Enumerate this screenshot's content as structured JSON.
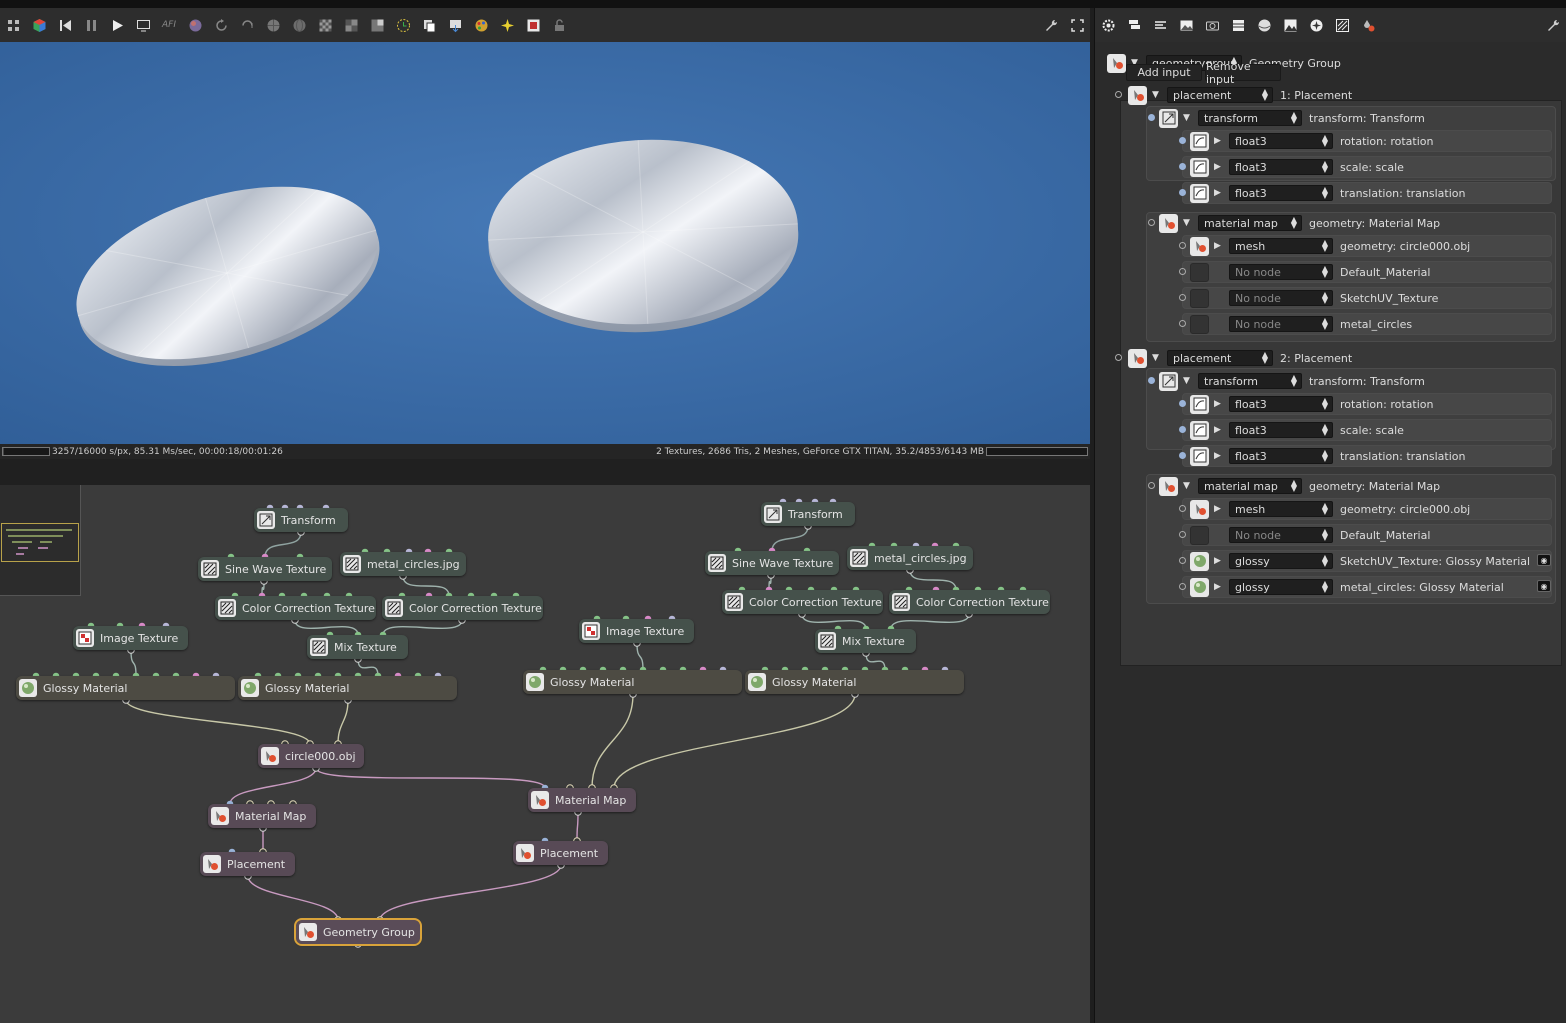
{
  "toolbar_left": {
    "icons": [
      "grid-snap-icon",
      "render-cube-icon",
      "skip-back-icon",
      "pause-icon",
      "play-icon",
      "screen-icon",
      "afi-icon",
      "color-sphere-icon",
      "rotate-icon",
      "refresh-icon",
      "globe-icon",
      "globe2-icon",
      "checker-icon",
      "checker2-icon",
      "checker3-icon",
      "clock-icon",
      "copy-icon",
      "export-icon",
      "palette-icon",
      "sparkle-icon",
      "focus-icon",
      "lock-icon"
    ],
    "afi_label": "AFI"
  },
  "toolbar_right": {
    "icons": [
      "settings-icon",
      "stack-icon",
      "layers-icon",
      "image-icon",
      "camera-icon",
      "box-icon",
      "sphere-icon",
      "picture-icon",
      "light-icon",
      "texture-icon",
      "drop-icon",
      "wrench-icon"
    ]
  },
  "status": {
    "left": "3257/16000 s/px, 85.31 Ms/sec, 00:00:18/00:01:26",
    "right": "2 Textures, 2686 Tris, 2 Meshes, GeForce GTX TITAN, 35.2/4853/6143 MB"
  },
  "nodes": [
    {
      "id": "t1",
      "label": "Transform",
      "cls": "tex",
      "icon": "transform"
    },
    {
      "id": "sw1",
      "label": "Sine Wave Texture",
      "cls": "tex",
      "icon": "texture"
    },
    {
      "id": "mc1",
      "label": "metal_circles.jpg",
      "cls": "tex",
      "icon": "texture"
    },
    {
      "id": "cc1",
      "label": "Color Correction Texture",
      "cls": "tex",
      "icon": "texture"
    },
    {
      "id": "cc2",
      "label": "Color Correction Texture",
      "cls": "tex",
      "icon": "texture"
    },
    {
      "id": "it1",
      "label": "Image Texture",
      "cls": "tex",
      "icon": "image"
    },
    {
      "id": "mx1",
      "label": "Mix Texture",
      "cls": "tex",
      "icon": "texture"
    },
    {
      "id": "gm1",
      "label": "Glossy Material",
      "cls": "mat",
      "icon": "sphere"
    },
    {
      "id": "gm2",
      "label": "Glossy Material",
      "cls": "mat",
      "icon": "sphere"
    },
    {
      "id": "obj1",
      "label": "circle000.obj",
      "cls": "geo",
      "icon": "geo"
    },
    {
      "id": "mm1",
      "label": "Material Map",
      "cls": "geo",
      "icon": "geo"
    },
    {
      "id": "pl1",
      "label": "Placement",
      "cls": "geo",
      "icon": "geo"
    },
    {
      "id": "gg",
      "label": "Geometry Group",
      "cls": "sel",
      "icon": "geo"
    },
    {
      "id": "t2",
      "label": "Transform",
      "cls": "tex",
      "icon": "transform"
    },
    {
      "id": "sw2",
      "label": "Sine Wave Texture",
      "cls": "tex",
      "icon": "texture"
    },
    {
      "id": "mc2",
      "label": "metal_circles.jpg",
      "cls": "tex",
      "icon": "texture"
    },
    {
      "id": "cc3",
      "label": "Color Correction Texture",
      "cls": "tex",
      "icon": "texture"
    },
    {
      "id": "cc4",
      "label": "Color Correction Texture",
      "cls": "tex",
      "icon": "texture"
    },
    {
      "id": "it2",
      "label": "Image Texture",
      "cls": "tex",
      "icon": "image"
    },
    {
      "id": "mx2",
      "label": "Mix Texture",
      "cls": "tex",
      "icon": "texture"
    },
    {
      "id": "gm3",
      "label": "Glossy Material",
      "cls": "mat",
      "icon": "sphere"
    },
    {
      "id": "gm4",
      "label": "Glossy Material",
      "cls": "mat",
      "icon": "sphere"
    },
    {
      "id": "mm2",
      "label": "Material Map",
      "cls": "geo",
      "icon": "geo"
    },
    {
      "id": "pl2",
      "label": "Placement",
      "cls": "geo",
      "icon": "geo"
    }
  ],
  "panel": {
    "root": {
      "type": "geometrygroup",
      "label": "Geometry Group"
    },
    "add_input": "Add input",
    "remove_input": "Remove input",
    "rows": [
      {
        "kind": "place",
        "type": "placement",
        "label": "1:  Placement"
      },
      {
        "kind": "xf",
        "type": "transform",
        "label": "transform:  Transform"
      },
      {
        "kind": "f3",
        "type": "float3",
        "label": "rotation:  rotation"
      },
      {
        "kind": "f3",
        "type": "float3",
        "label": "scale:  scale"
      },
      {
        "kind": "f3",
        "type": "float3",
        "label": "translation:  translation"
      },
      {
        "kind": "mmap",
        "type": "material map",
        "label": "geometry:  Material Map"
      },
      {
        "kind": "mesh",
        "type": "mesh",
        "label": "geometry:  circle000.obj"
      },
      {
        "kind": "none",
        "type": "No node",
        "label": "Default_Material"
      },
      {
        "kind": "none",
        "type": "No node",
        "label": "SketchUV_Texture"
      },
      {
        "kind": "none",
        "type": "No node",
        "label": "metal_circles"
      },
      {
        "kind": "place",
        "type": "placement",
        "label": "2:  Placement"
      },
      {
        "kind": "xf",
        "type": "transform",
        "label": "transform:  Transform"
      },
      {
        "kind": "f3",
        "type": "float3",
        "label": "rotation:  rotation"
      },
      {
        "kind": "f3",
        "type": "float3",
        "label": "scale:  scale"
      },
      {
        "kind": "f3",
        "type": "float3",
        "label": "translation:  translation"
      },
      {
        "kind": "mmap",
        "type": "material map",
        "label": "geometry:  Material Map"
      },
      {
        "kind": "mesh",
        "type": "mesh",
        "label": "geometry:  circle000.obj"
      },
      {
        "kind": "none",
        "type": "No node",
        "label": "Default_Material"
      },
      {
        "kind": "glossy",
        "type": "glossy",
        "label": "SketchUV_Texture:  Glossy Material"
      },
      {
        "kind": "glossy",
        "type": "glossy",
        "label": "metal_circles:  Glossy Material"
      }
    ]
  }
}
